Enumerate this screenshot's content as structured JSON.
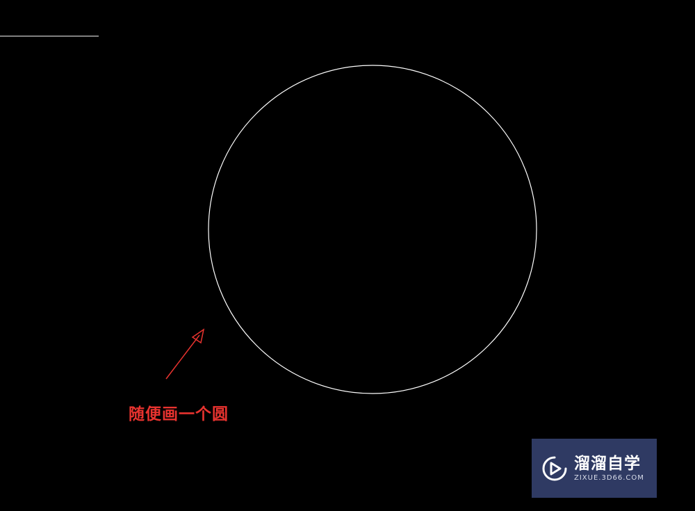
{
  "annotation": {
    "text": "随便画一个圆",
    "color": "#e8332f"
  },
  "drawing": {
    "background_color": "#000000",
    "line_color": "#ffffff",
    "entities": [
      "line",
      "circle"
    ]
  },
  "watermark": {
    "brand": "溜溜自学",
    "url": "ZIXUE.3D66.COM",
    "icon": "play-logo-icon",
    "background_color": "#2f3a63"
  }
}
